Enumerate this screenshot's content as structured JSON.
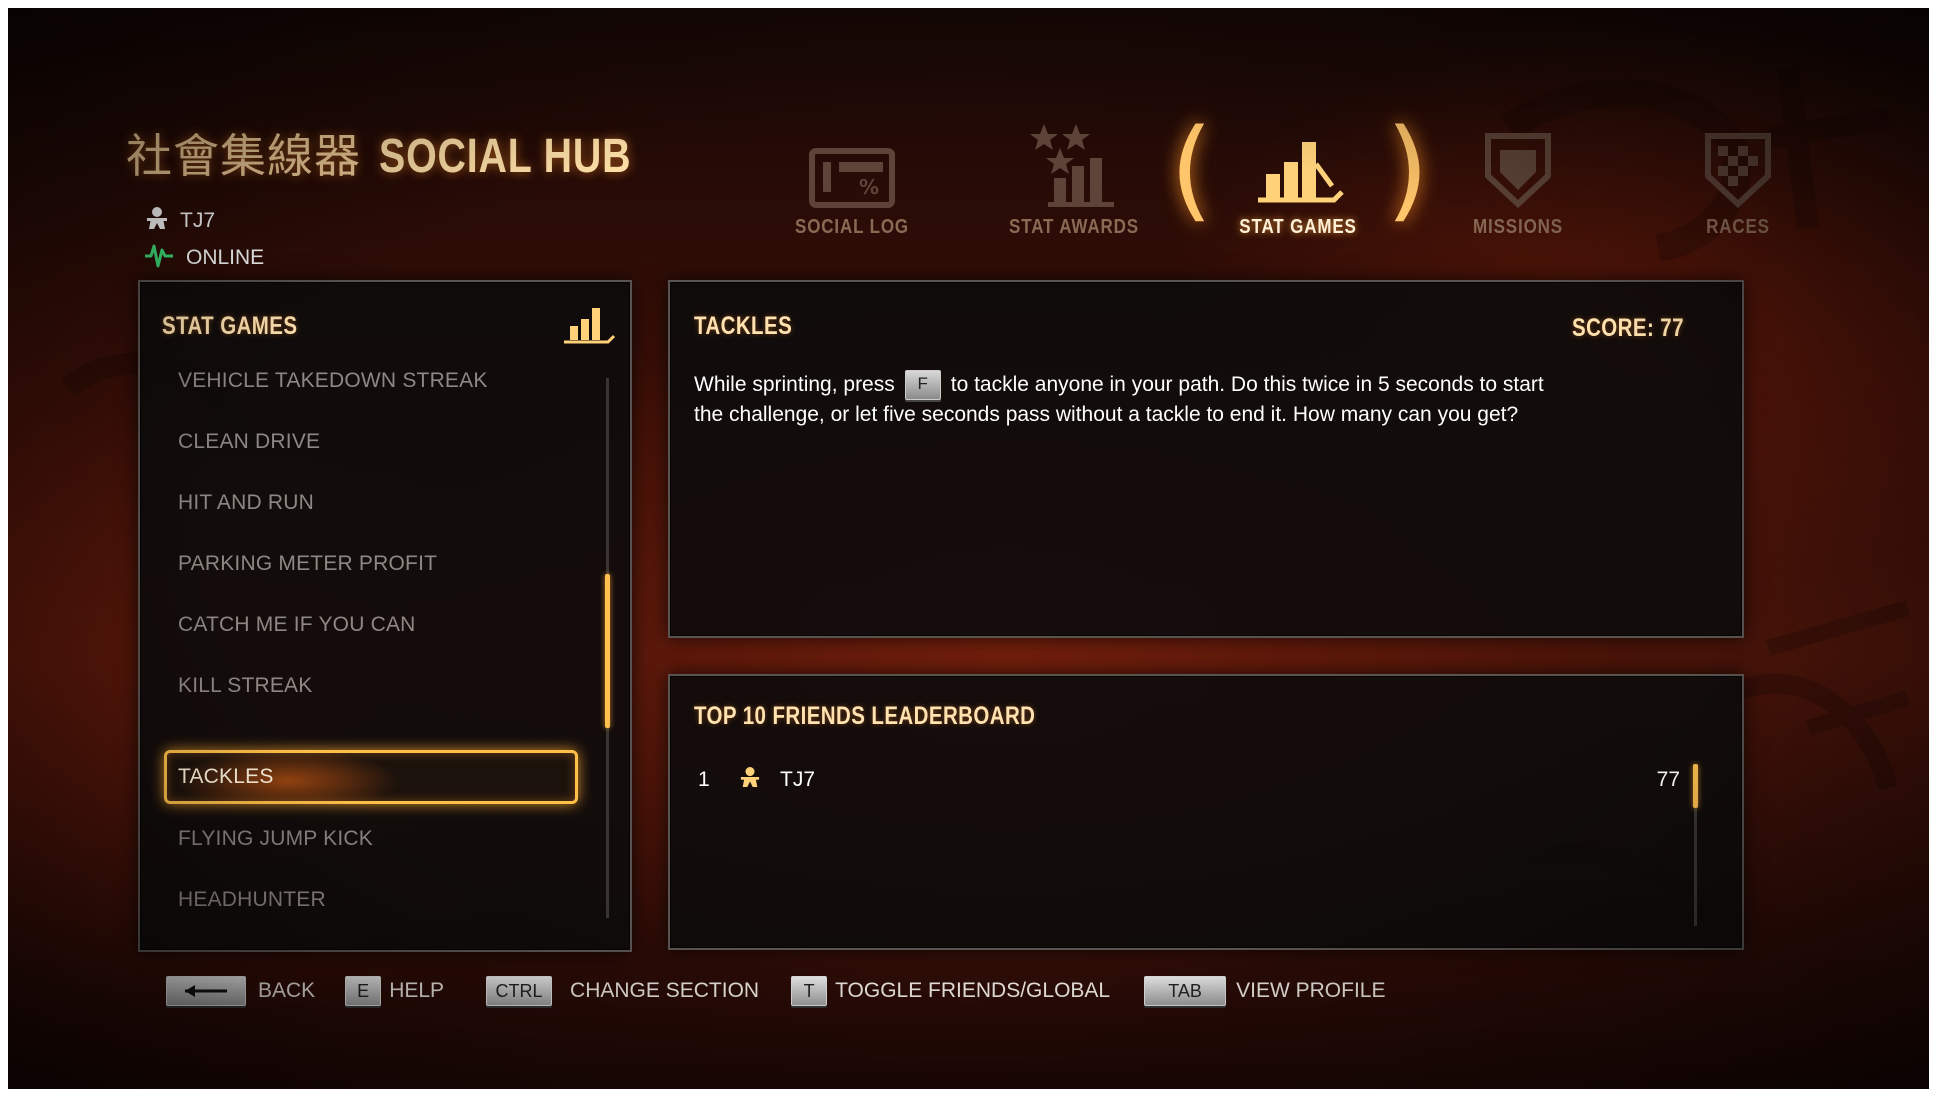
{
  "header": {
    "title_cjk": "社會集線器",
    "title": "SOCIAL HUB",
    "username": "TJ7",
    "status": "ONLINE"
  },
  "tabs": [
    {
      "label": "SOCIAL LOG",
      "icon": "social-log-icon"
    },
    {
      "label": "STAT AWARDS",
      "icon": "stat-awards-icon"
    },
    {
      "label": "STAT GAMES",
      "icon": "stat-games-icon",
      "active": true
    },
    {
      "label": "MISSIONS",
      "icon": "missions-icon"
    },
    {
      "label": "RACES",
      "icon": "races-icon"
    }
  ],
  "stat_games": {
    "title": "STAT GAMES",
    "items": [
      "VEHICLE TAKEDOWN STREAK",
      "CLEAN DRIVE",
      "HIT AND RUN",
      "PARKING METER PROFIT",
      "CATCH ME IF YOU CAN",
      "KILL STREAK",
      "TACKLES",
      "FLYING JUMP KICK",
      "HEADHUNTER"
    ],
    "selected": "TACKLES"
  },
  "detail": {
    "title": "TACKLES",
    "score": "SCORE: 77",
    "desc_before_key": "While sprinting, press",
    "key": "F",
    "desc_after_key": "to tackle anyone in your path. Do this twice in 5 seconds to start the challenge, or let five seconds pass without a tackle to end it. How many can you get?"
  },
  "leaderboard": {
    "title": "TOP 10 FRIENDS LEADERBOARD",
    "rows": [
      {
        "rank": "1",
        "name": "TJ7",
        "score": "77"
      }
    ]
  },
  "footer": {
    "back": "BACK",
    "help_key": "E",
    "help": "HELP",
    "change_key": "CTRL",
    "change": "CHANGE SECTION",
    "toggle_key": "T",
    "toggle": "TOGGLE FRIENDS/GLOBAL",
    "profile_key": "TAB",
    "profile": "VIEW PROFILE"
  },
  "colors": {
    "accent": "#ffc04a",
    "online": "#3fe07a",
    "tab_inactive": "#8a6a55"
  }
}
